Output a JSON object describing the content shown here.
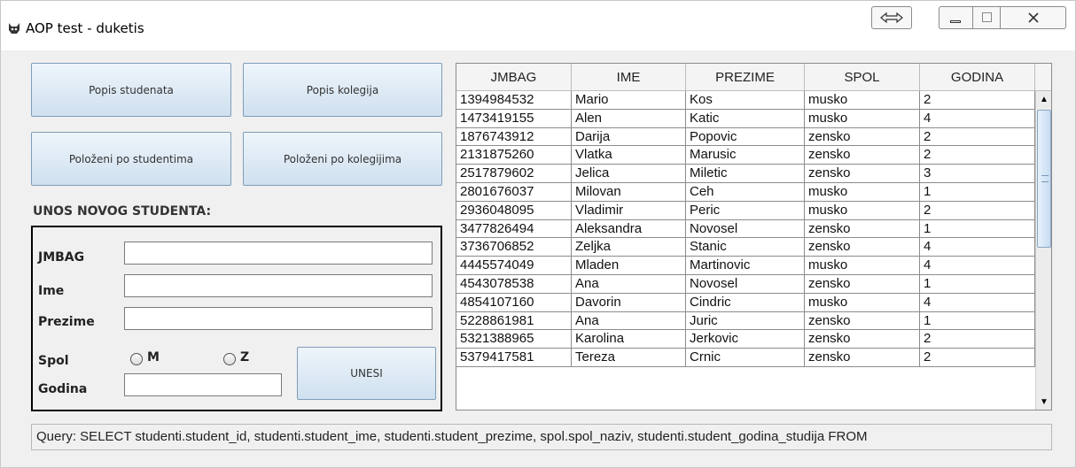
{
  "window": {
    "title": "AOP test - duketis",
    "icons": {
      "app": "app-cat-icon",
      "swap": "swap-horizontal-icon",
      "minimize": "minimize-icon",
      "maximize": "maximize-icon",
      "close": "close-icon"
    }
  },
  "buttons": {
    "popis_studenata": "Popis studenata",
    "popis_kolegija": "Popis kolegija",
    "polozeni_po_studentima": "Položeni po studentima",
    "polozeni_po_kolegijima": "Položeni po kolegijima",
    "unesi": "UNESI"
  },
  "form": {
    "section_title": "UNOS NOVOG STUDENTA:",
    "jmbag_label": "JMBAG",
    "ime_label": "Ime",
    "prezime_label": "Prezime",
    "spol_label": "Spol",
    "godina_label": "Godina",
    "radio_m": "M",
    "radio_z": "Z",
    "jmbag_value": "",
    "ime_value": "",
    "prezime_value": "",
    "godina_value": ""
  },
  "table": {
    "columns": [
      "JMBAG",
      "IME",
      "PREZIME",
      "SPOL",
      "GODINA"
    ],
    "rows": [
      [
        "1394984532",
        "Mario",
        "Kos",
        "musko",
        "2"
      ],
      [
        "1473419155",
        "Alen",
        "Katic",
        "musko",
        "4"
      ],
      [
        "1876743912",
        "Darija",
        "Popovic",
        "zensko",
        "2"
      ],
      [
        "2131875260",
        "Vlatka",
        "Marusic",
        "zensko",
        "2"
      ],
      [
        "2517879602",
        "Jelica",
        "Miletic",
        "zensko",
        "3"
      ],
      [
        "2801676037",
        "Milovan",
        "Ceh",
        "musko",
        "1"
      ],
      [
        "2936048095",
        "Vladimir",
        "Peric",
        "musko",
        "2"
      ],
      [
        "3477826494",
        "Aleksandra",
        "Novosel",
        "zensko",
        "1"
      ],
      [
        "3736706852",
        "Zeljka",
        "Stanic",
        "zensko",
        "4"
      ],
      [
        "4445574049",
        "Mladen",
        "Martinovic",
        "musko",
        "4"
      ],
      [
        "4543078538",
        "Ana",
        "Novosel",
        "zensko",
        "1"
      ],
      [
        "4854107160",
        "Davorin",
        "Cindric",
        "musko",
        "4"
      ],
      [
        "5228861981",
        "Ana",
        "Juric",
        "zensko",
        "1"
      ],
      [
        "5321388965",
        "Karolina",
        "Jerkovic",
        "zensko",
        "2"
      ],
      [
        "5379417581",
        "Tereza",
        "Crnic",
        "zensko",
        "2"
      ]
    ]
  },
  "query": "Query: SELECT studenti.student_id, studenti.student_ime, studenti.student_prezime, spol.spol_naziv, studenti.student_godina_studija FROM"
}
